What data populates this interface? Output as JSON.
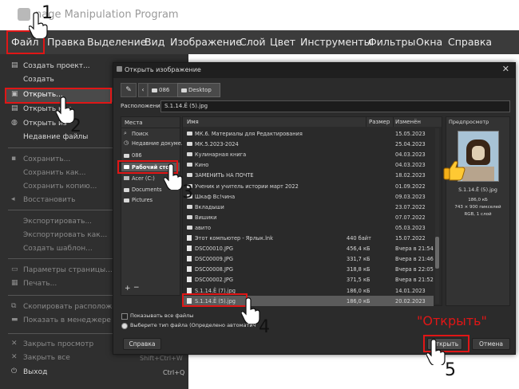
{
  "window": {
    "title": "nage Manipulation Program"
  },
  "menubar": {
    "items": [
      {
        "label": "Файл"
      },
      {
        "label": "Правка"
      },
      {
        "label": "Выделение"
      },
      {
        "label": "Вид"
      },
      {
        "label": "Изображение"
      },
      {
        "label": "Слой"
      },
      {
        "label": "Цвет"
      },
      {
        "label": "Инструменты"
      },
      {
        "label": "Фильтры"
      },
      {
        "label": "Окна"
      },
      {
        "label": "Справка"
      }
    ]
  },
  "file_menu": {
    "items": [
      {
        "label": "Создать проект..."
      },
      {
        "label": "Создать"
      },
      {
        "label": "Открыть..."
      },
      {
        "label": "Открыть как"
      },
      {
        "label": "Открыть из"
      },
      {
        "label": "Недавние файлы"
      },
      {
        "label": "Сохранить..."
      },
      {
        "label": "Сохранить как..."
      },
      {
        "label": "Сохранить копию..."
      },
      {
        "label": "Восстановить"
      },
      {
        "label": "Экспортировать..."
      },
      {
        "label": "Экспортировать как..."
      },
      {
        "label": "Создать шаблон..."
      },
      {
        "label": "Параметры страницы..."
      },
      {
        "label": "Печать..."
      },
      {
        "label": "Скопировать расположение"
      },
      {
        "label": "Показать в менеджере файл"
      },
      {
        "label": "Закрыть просмотр"
      },
      {
        "label": "Закрыть все"
      },
      {
        "label": "Выход"
      }
    ],
    "shortcuts": {
      "close_all": "Shift+Ctrl+W",
      "quit": "Ctrl+Q"
    }
  },
  "dialog": {
    "title": "Открыть изображение",
    "path_crumbs": [
      "086",
      "Desktop"
    ],
    "location_label": "Расположение:",
    "location_value": "S.1.14.Ё (5).jpg",
    "places_header": "Места",
    "places": [
      {
        "label": "Поиск"
      },
      {
        "label": "Недавние докуме..."
      },
      {
        "label": "086"
      },
      {
        "label": "Рабочий стол"
      },
      {
        "label": "Acer (C:)"
      },
      {
        "label": "Documents"
      },
      {
        "label": "Pictures"
      }
    ],
    "columns": {
      "name": "Имя",
      "size": "Размер",
      "modified": "Изменён"
    },
    "files": [
      {
        "name": "МК.6. Материалы для Редактирования",
        "size": "",
        "modified": "15.05.2023"
      },
      {
        "name": "МК.5.2023-2024",
        "size": "",
        "modified": "25.04.2023"
      },
      {
        "name": "Кулинарная книга",
        "size": "",
        "modified": "04.03.2023"
      },
      {
        "name": "Кино",
        "size": "",
        "modified": "04.03.2023"
      },
      {
        "name": "ЗАМЕНИТЬ НА ПОЧТЕ",
        "size": "",
        "modified": "18.02.2023"
      },
      {
        "name": "Ученик и учитель истории март 2022",
        "size": "",
        "modified": "01.09.2022"
      },
      {
        "name": "Шкаф Вс!чина",
        "size": "",
        "modified": "09.03.2023"
      },
      {
        "name": "Вкладыши",
        "size": "",
        "modified": "23.07.2022"
      },
      {
        "name": "Вишики",
        "size": "",
        "modified": "07.07.2022"
      },
      {
        "name": "авито",
        "size": "",
        "modified": "05.03.2023"
      },
      {
        "name": "Этот компьютер - Ярлык.lnk",
        "size": "440 байт",
        "modified": "15.07.2022"
      },
      {
        "name": "DSC00010.JPG",
        "size": "456,4 кБ",
        "modified": "Вчера в 21:54"
      },
      {
        "name": "DSC00009.JPG",
        "size": "331,7 кБ",
        "modified": "Вчера в 21:46"
      },
      {
        "name": "DSC00008.JPG",
        "size": "318,8 кБ",
        "modified": "Вчера в 22:05"
      },
      {
        "name": "DSC00002.JPG",
        "size": "371,5 кБ",
        "modified": "Вчера в 21:52"
      },
      {
        "name": "S.1.14.Ё (7).jpg",
        "size": "186,0 кБ",
        "modified": "14.01.2023"
      },
      {
        "name": "S.1.14.Ё (5).jpg",
        "size": "186,0 кБ",
        "modified": "20.02.2023"
      }
    ],
    "preview": {
      "header": "Предпросмотр",
      "filename": "S.1.14.Ё (5).jpg",
      "size": "186,0 кБ",
      "dims": "743 × 900 пикселей",
      "mode": "RGB, 1 слой"
    },
    "show_all_files": "Показывать все файлы",
    "file_type": "Выберите тип файла (Определено автоматич",
    "help_button": "Справка",
    "open_button": "Открыть",
    "cancel_button": "Отмена"
  },
  "annotations": {
    "steps": [
      "1",
      "2",
      "3",
      "4",
      "5"
    ],
    "open_callout": "\"Открыть\"",
    "accent_color": "#e01616"
  }
}
